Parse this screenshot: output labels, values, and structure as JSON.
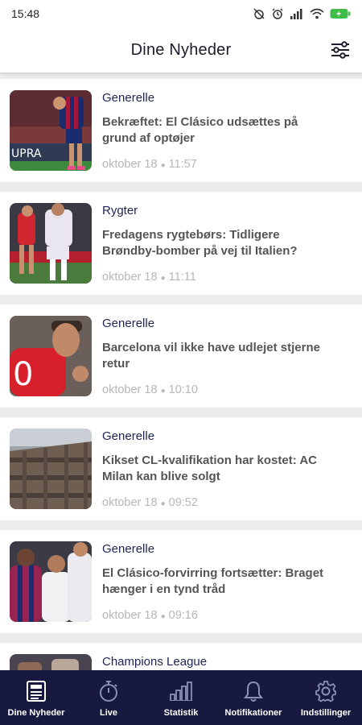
{
  "status_bar": {
    "time": "15:48",
    "icons": [
      "alarm-off-icon",
      "alarm-icon",
      "signal-icon",
      "wifi-icon",
      "battery-icon"
    ]
  },
  "header": {
    "title": "Dine Nyheder",
    "filter_icon": "sliders-icon"
  },
  "articles": [
    {
      "category": "Generelle",
      "title": "Bekræftet: El Clásico udsættes på grund af optøjer",
      "date": "oktober 18",
      "time": "11:57"
    },
    {
      "category": "Rygter",
      "title": "Fredagens rygtebørs: Tidligere Brøndby-bomber på vej til Italien?",
      "date": "oktober 18",
      "time": "11:11"
    },
    {
      "category": "Generelle",
      "title": "Barcelona vil ikke have udlejet stjerne retur",
      "date": "oktober 18",
      "time": "10:10"
    },
    {
      "category": "Generelle",
      "title": "Kikset CL-kvalifikation har kostet: AC Milan kan blive solgt",
      "date": "oktober 18",
      "time": "09:52"
    },
    {
      "category": "Generelle",
      "title": "El Clásico-forvirring fortsætter: Braget hænger i en tynd tråd",
      "date": "oktober 18",
      "time": "09:16"
    },
    {
      "category": "Champions League",
      "title": "",
      "date": "",
      "time": ""
    }
  ],
  "meta_separator": "●",
  "nav": [
    {
      "label": "Dine Nyheder",
      "icon": "newspaper-icon",
      "active": true
    },
    {
      "label": "Live",
      "icon": "stopwatch-icon",
      "active": false
    },
    {
      "label": "Statistik",
      "icon": "bar-chart-icon",
      "active": false
    },
    {
      "label": "Notifikationer",
      "icon": "bell-icon",
      "active": false
    },
    {
      "label": "Indstillinger",
      "icon": "gear-icon",
      "active": false
    }
  ],
  "colors": {
    "nav_bg": "#171a3e",
    "category": "#1f2453",
    "nav_icon_inactive": "#8a8fb5",
    "nav_icon_active": "#ffffff"
  }
}
